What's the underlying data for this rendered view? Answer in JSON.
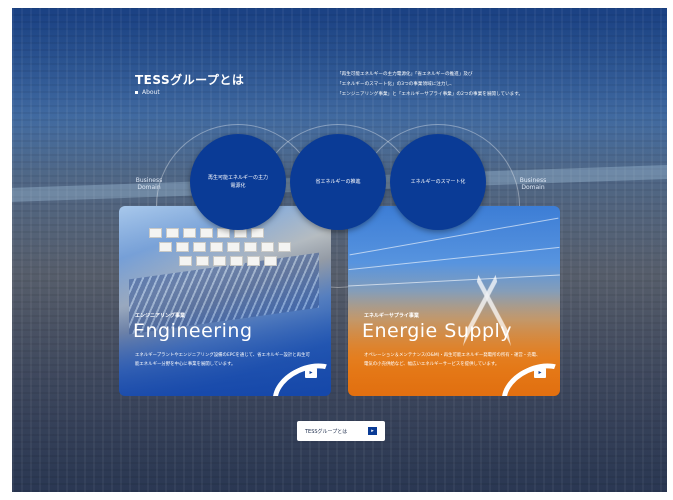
{
  "section": {
    "title": "TESSグループとは",
    "subtitle": "About"
  },
  "intro": {
    "lines": [
      "「再生可能エネルギーの主力電源化」「省エネルギーの推進」及び",
      "「エネルギーのスマート化」の3つの事業領域に注力し、",
      "「エンジニアリング事業」と「エネルギーサプライ事業」の2つの事業を展開しています。"
    ]
  },
  "domain_label_left": "Business Domain",
  "domain_label_right": "Business Domain",
  "domains": [
    {
      "label": "再生可能エネルギーの主力電源化"
    },
    {
      "label": "省エネルギーの推進"
    },
    {
      "label": "エネルギーのスマート化"
    }
  ],
  "cards": [
    {
      "category": "エンジニアリング事業",
      "title": "Engineering",
      "description": "エネルギープラントやエンジニアリング設備のEPCを通じて、省エネルギー設計と再生可能エネルギー分野を中心に事業を展開しています。"
    },
    {
      "category": "エネルギーサプライ事業",
      "title": "Energie Supply",
      "description": "オペレーション＆メンテナンス(O&M)・再生可能エネルギー発電所の所有・運営・売電、電気の小売供給など、幅広いエネルギーサービスを提供しています。"
    }
  ],
  "cta": {
    "label": "TESSグループとは",
    "icon": "arrow-right-icon"
  },
  "colors": {
    "primary_blue": "#0a3b96",
    "supply_orange": "#e6821f",
    "text_white": "#ffffff"
  }
}
